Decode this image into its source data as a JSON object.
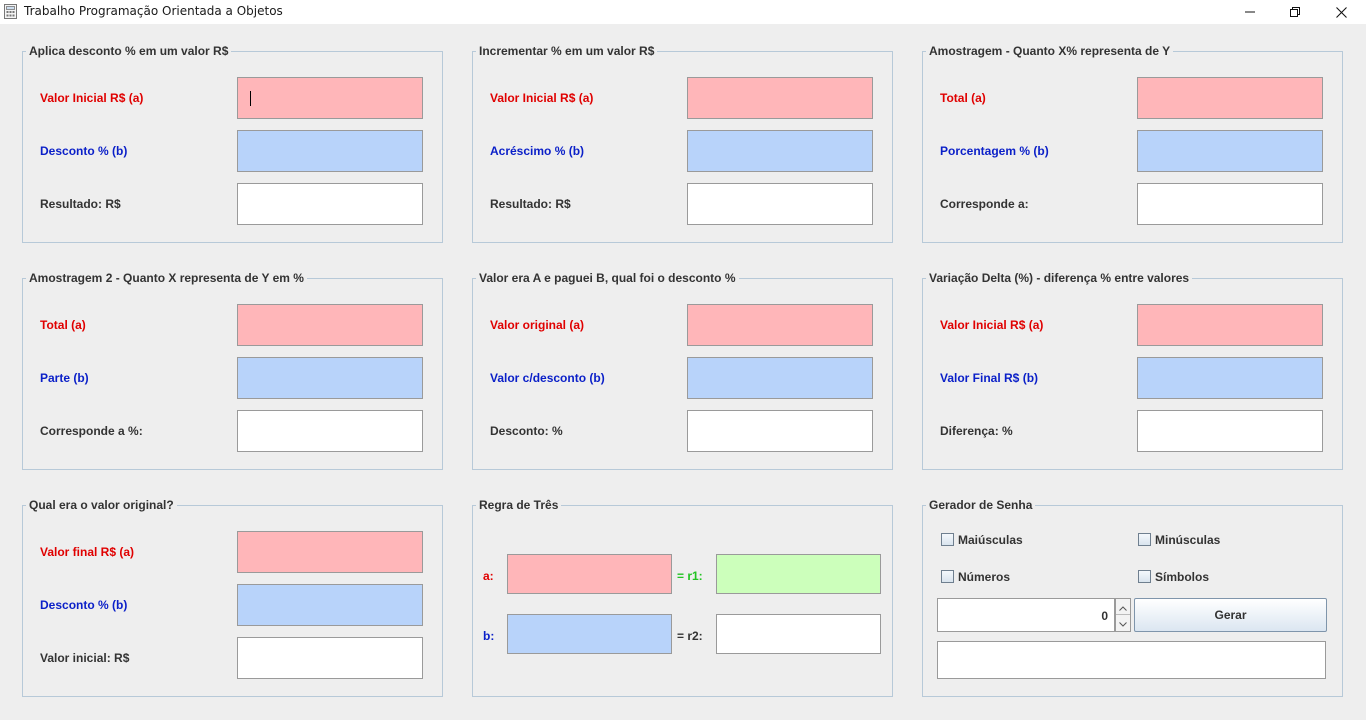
{
  "window": {
    "title": "Trabalho Programação Orientada a Objetos",
    "controls": {
      "minimize": "minimize-icon",
      "restore": "restore-icon",
      "close": "close-icon"
    }
  },
  "colors": {
    "input_a": "#ffb6b9",
    "input_b": "#b8d3fa",
    "result": "#ffffff",
    "r1_result": "#ccffbb",
    "label_a": "#e00000",
    "label_b": "#0a1fc8",
    "label_r1": "#22c322"
  },
  "panels": {
    "desconto": {
      "title": "Aplica desconto % em um valor R$",
      "label_a": "Valor Inicial R$ (a)",
      "label_b": "Desconto % (b)",
      "label_result": "Resultado: R$",
      "value_a": "",
      "value_b": "",
      "value_result": ""
    },
    "incremento": {
      "title": "Incrementar % em um valor R$",
      "label_a": "Valor Inicial R$ (a)",
      "label_b": "Acréscimo % (b)",
      "label_result": "Resultado: R$",
      "value_a": "",
      "value_b": "",
      "value_result": ""
    },
    "amostragem": {
      "title": "Amostragem - Quanto X% representa de Y",
      "label_a": "Total (a)",
      "label_b": "Porcentagem % (b)",
      "label_result": "Corresponde a:",
      "value_a": "",
      "value_b": "",
      "value_result": ""
    },
    "amostragem2": {
      "title": "Amostragem 2 - Quanto X representa de Y em %",
      "label_a": "Total (a)",
      "label_b": "Parte (b)",
      "label_result": "Corresponde a %:",
      "value_a": "",
      "value_b": "",
      "value_result": ""
    },
    "desconto_pago": {
      "title": "Valor era A e paguei B, qual foi o desconto %",
      "label_a": "Valor original (a)",
      "label_b": "Valor c/desconto (b)",
      "label_result": "Desconto: %",
      "value_a": "",
      "value_b": "",
      "value_result": ""
    },
    "variacao": {
      "title": "Variação Delta (%) - diferença % entre valores",
      "label_a": "Valor Inicial R$ (a)",
      "label_b": "Valor Final R$ (b)",
      "label_result": "Diferença: %",
      "value_a": "",
      "value_b": "",
      "value_result": ""
    },
    "valor_original": {
      "title": "Qual era o valor original?",
      "label_a": "Valor final R$ (a)",
      "label_b": "Desconto % (b)",
      "label_result": "Valor inicial: R$",
      "value_a": "",
      "value_b": "",
      "value_result": ""
    },
    "regra_tres": {
      "title": "Regra de Três",
      "label_a": "a:",
      "label_b": "b:",
      "label_r1": "= r1:",
      "label_r2": "= r2:",
      "value_a": "",
      "value_b": "",
      "value_r1": "",
      "value_r2": ""
    },
    "senha": {
      "title": "Gerador de Senha",
      "options": [
        {
          "label": "Maiúsculas",
          "checked": false
        },
        {
          "label": "Minúsculas",
          "checked": false
        },
        {
          "label": "Números",
          "checked": false
        },
        {
          "label": "Símbolos",
          "checked": false
        }
      ],
      "length_value": "0",
      "generate_label": "Gerar",
      "output_value": ""
    }
  }
}
